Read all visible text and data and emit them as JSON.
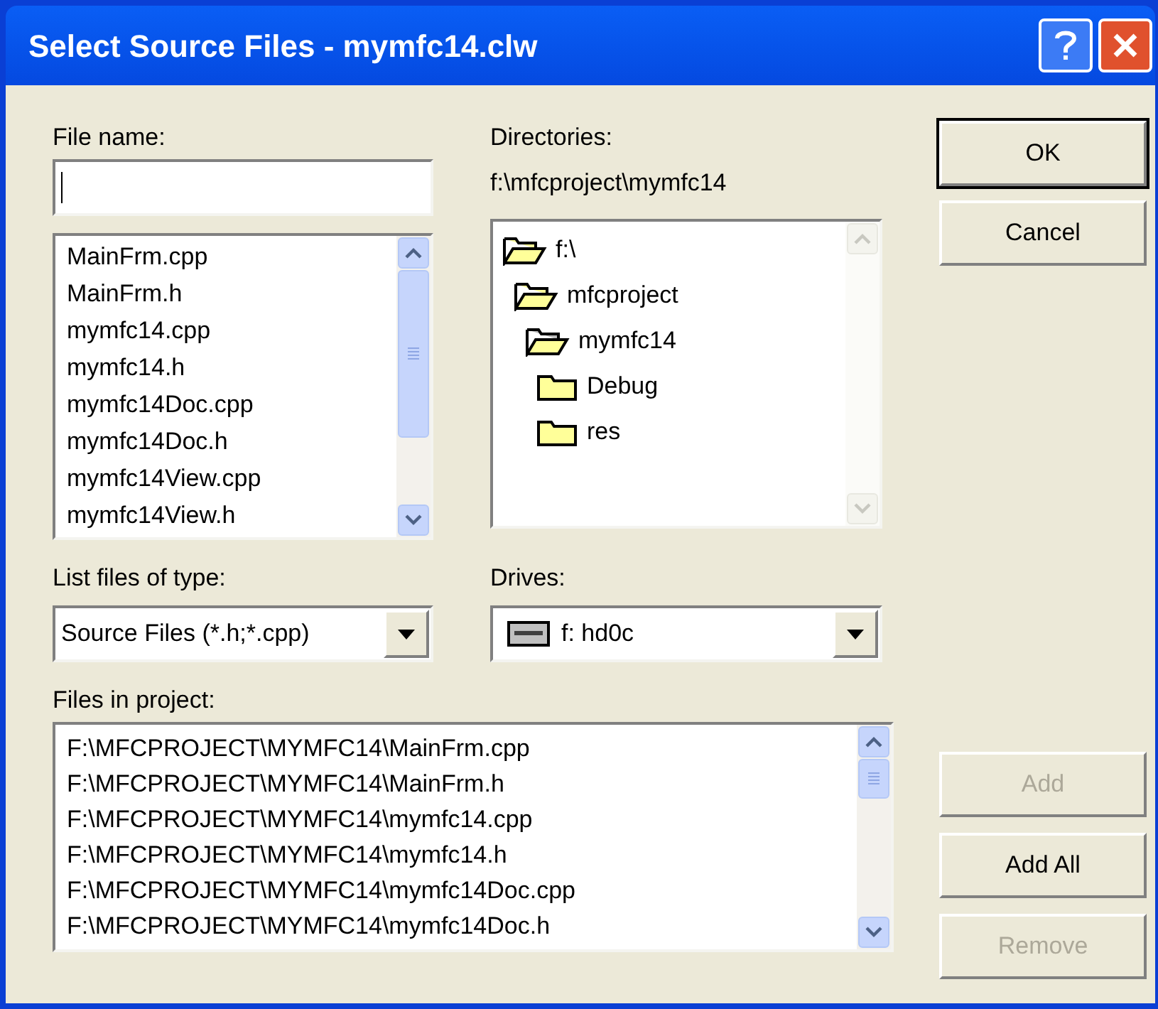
{
  "window": {
    "title": "Select Source Files - mymfc14.clw"
  },
  "file_name": {
    "label": "File name:"
  },
  "files": [
    "MainFrm.cpp",
    "MainFrm.h",
    "mymfc14.cpp",
    "mymfc14.h",
    "mymfc14Doc.cpp",
    "mymfc14Doc.h",
    "mymfc14View.cpp",
    "mymfc14View.h"
  ],
  "directories": {
    "label": "Directories:",
    "path": "f:\\mfcproject\\mymfc14",
    "tree": [
      {
        "name": "f:\\",
        "kind": "open",
        "children": [
          {
            "name": "mfcproject",
            "kind": "open",
            "children": [
              {
                "name": "mymfc14",
                "kind": "current",
                "children": [
                  {
                    "name": "Debug",
                    "kind": "closed"
                  },
                  {
                    "name": "res",
                    "kind": "closed"
                  }
                ]
              }
            ]
          }
        ]
      }
    ]
  },
  "file_type": {
    "label": "List files of type:",
    "value": "Source Files (*.h;*.cpp)"
  },
  "drives": {
    "label": "Drives:",
    "value": "f: hd0c"
  },
  "project_files": {
    "label": "Files in project:",
    "items": [
      "F:\\MFCPROJECT\\MYMFC14\\MainFrm.cpp",
      "F:\\MFCPROJECT\\MYMFC14\\MainFrm.h",
      "F:\\MFCPROJECT\\MYMFC14\\mymfc14.cpp",
      "F:\\MFCPROJECT\\MYMFC14\\mymfc14.h",
      "F:\\MFCPROJECT\\MYMFC14\\mymfc14Doc.cpp",
      "F:\\MFCPROJECT\\MYMFC14\\mymfc14Doc.h"
    ]
  },
  "top_buttons": [
    {
      "label": "OK",
      "default": true,
      "disabled": false
    },
    {
      "label": "Cancel",
      "default": false,
      "disabled": false
    }
  ],
  "side_buttons": [
    {
      "label": "Add",
      "default": false,
      "disabled": true
    },
    {
      "label": "Add All",
      "default": false,
      "disabled": false
    },
    {
      "label": "Remove",
      "default": false,
      "disabled": true
    }
  ]
}
